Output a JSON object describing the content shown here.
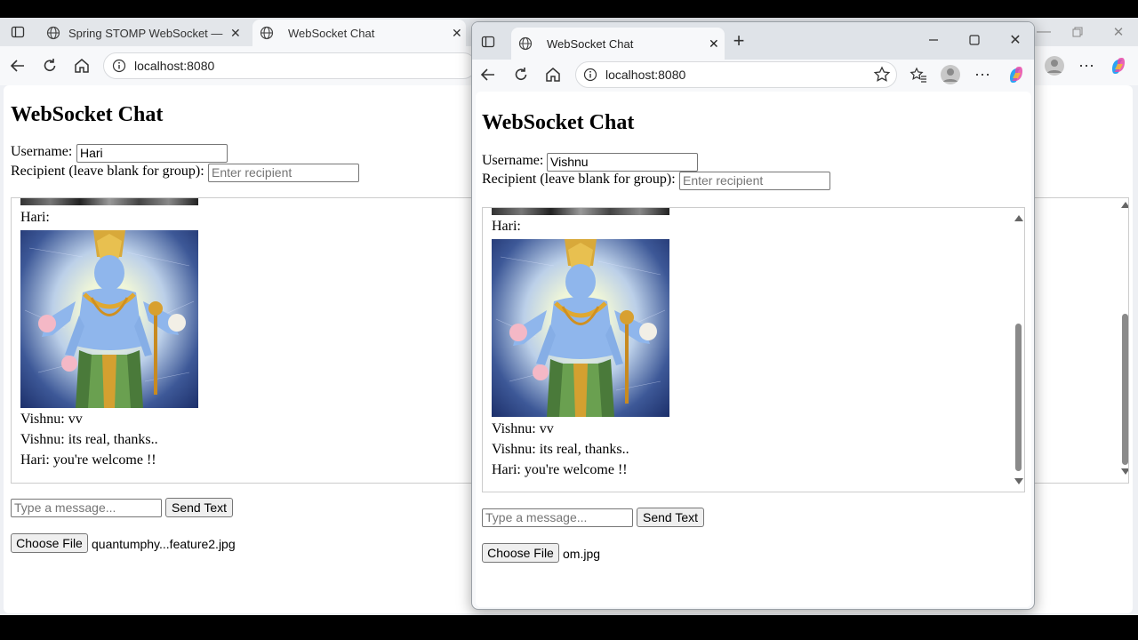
{
  "back_browser": {
    "tabs": [
      {
        "title": "Spring STOMP WebSocket — Flo"
      },
      {
        "title": "WebSocket Chat"
      }
    ],
    "address": "localhost:8080"
  },
  "front_browser": {
    "tab_title": "WebSocket Chat",
    "address": "localhost:8080"
  },
  "left_page": {
    "heading": "WebSocket Chat",
    "username_label": "Username:",
    "username_value": "Hari",
    "recipient_label": "Recipient (leave blank for group):",
    "recipient_placeholder": "Enter recipient",
    "messages": [
      {
        "text": "Hari:"
      },
      {
        "text": "Vishnu: vv"
      },
      {
        "text": "Vishnu: its real, thanks.."
      },
      {
        "text": "Hari: you're welcome !!"
      }
    ],
    "message_placeholder": "Type a message...",
    "send_label": "Send Text",
    "choose_file_label": "Choose File",
    "file_name": "quantumphy...feature2.jpg"
  },
  "right_page": {
    "heading": "WebSocket Chat",
    "username_label": "Username:",
    "username_value": "Vishnu",
    "recipient_label": "Recipient (leave blank for group):",
    "recipient_placeholder": "Enter recipient",
    "messages": [
      {
        "text": "Hari:"
      },
      {
        "text": "Vishnu: vv"
      },
      {
        "text": "Vishnu: its real, thanks.."
      },
      {
        "text": "Hari: you're welcome !!"
      }
    ],
    "message_placeholder": "Type a message...",
    "send_label": "Send Text",
    "choose_file_label": "Choose File",
    "file_name": "om.jpg"
  },
  "icons": [
    "tab-actions-icon",
    "globe-icon",
    "close-icon",
    "back-icon",
    "reload-icon",
    "home-icon",
    "info-icon",
    "star-icon",
    "favorites-icon",
    "profile-icon",
    "more-icon",
    "copilot-icon",
    "minimize-icon",
    "maximize-icon",
    "new-tab-icon"
  ],
  "colors": {
    "accent": "#0078d4",
    "page_bg": "#ffffff",
    "chrome_bg": "#f7f8fa"
  }
}
